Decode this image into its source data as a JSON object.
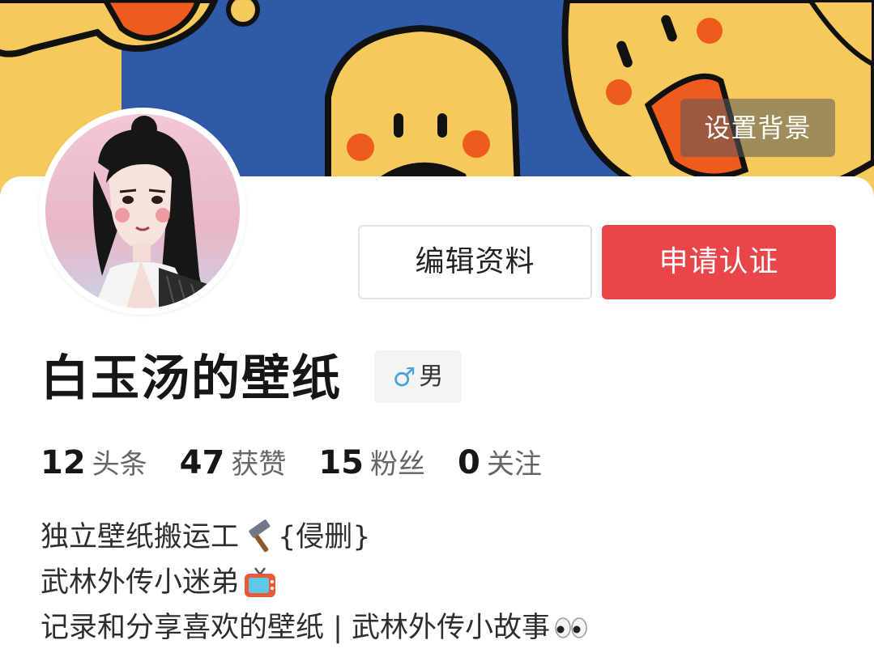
{
  "header": {
    "set_background_label": "设置背景"
  },
  "profile": {
    "name": "白玉汤的壁纸",
    "gender_symbol": "♂",
    "gender_label": "男",
    "edit_label": "编辑资料",
    "verify_label": "申请认证"
  },
  "stats": [
    {
      "value": "12",
      "label": "头条"
    },
    {
      "value": "47",
      "label": "获赞"
    },
    {
      "value": "15",
      "label": "粉丝"
    },
    {
      "value": "0",
      "label": "关注"
    }
  ],
  "bio": {
    "line1": "独立壁纸搬运工",
    "line1_suffix": " {侵删}",
    "line1_icon": "hammer-icon",
    "line2": "武林外传小迷弟",
    "line2_icon": "tv-icon",
    "line3": "记录和分享喜欢的壁纸 | 武林外传小故事",
    "line3_icon": "eyes-icon"
  },
  "colors": {
    "accent_red": "#e8464a",
    "banner_yellow": "#f6c95c",
    "banner_blue": "#2f5aa8",
    "gender_blue": "#4aa3df"
  }
}
